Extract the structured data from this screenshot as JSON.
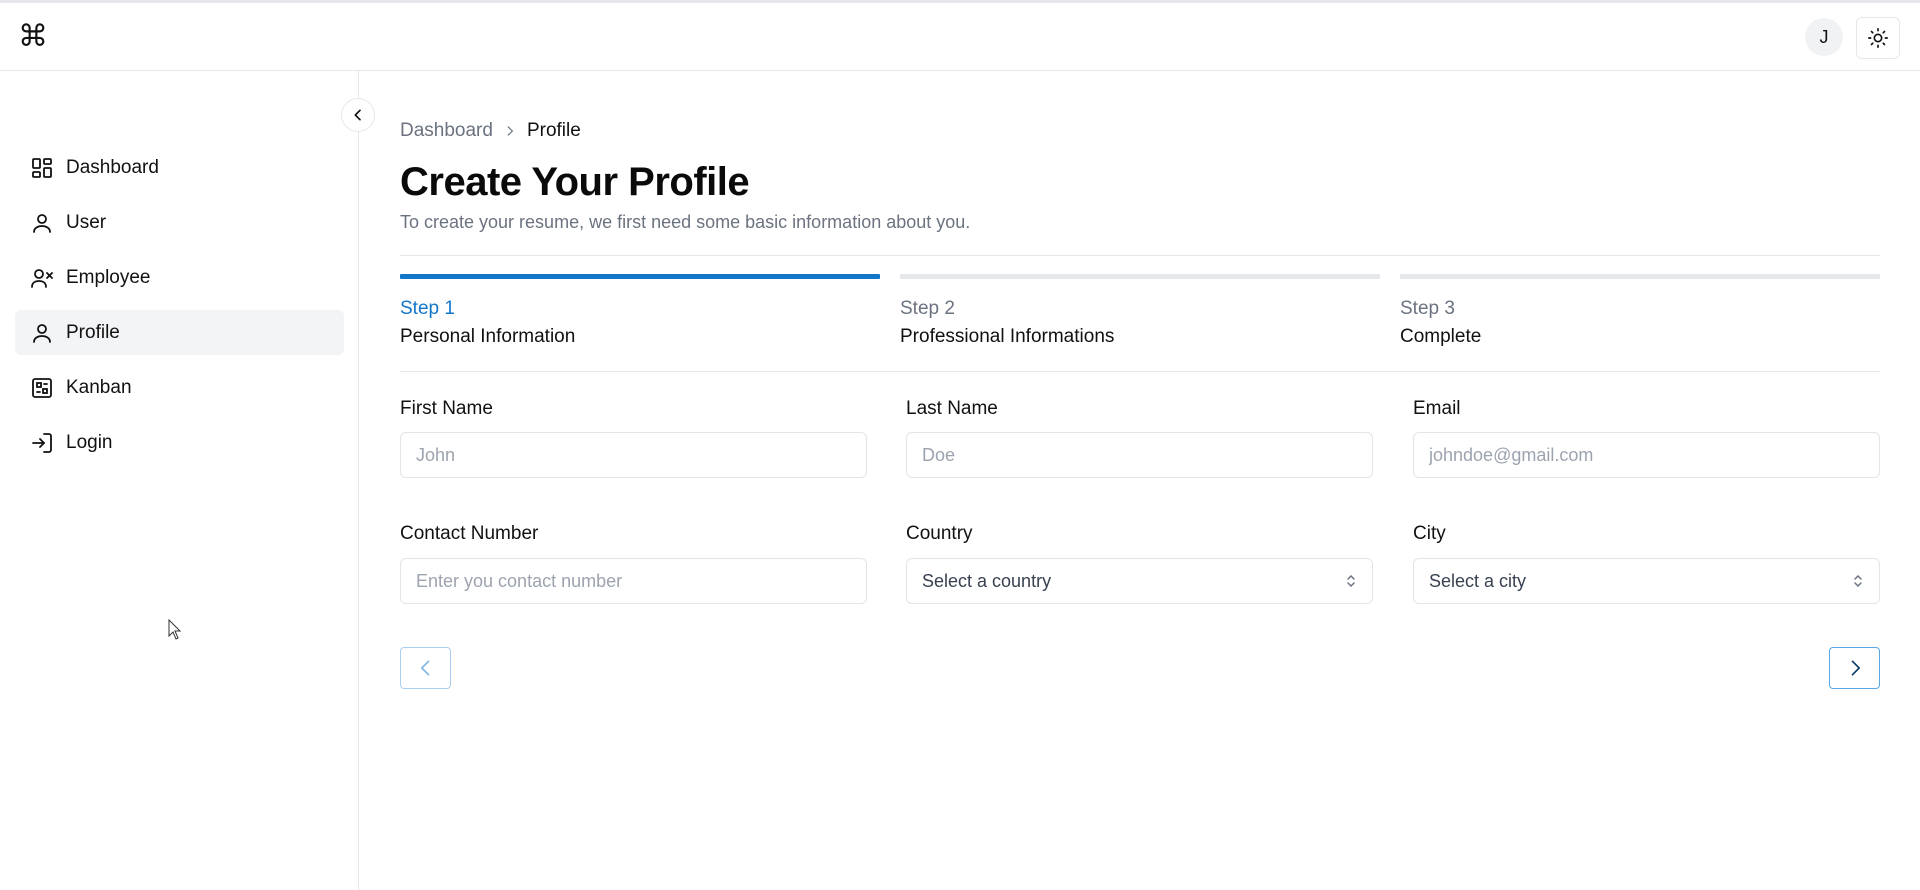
{
  "header": {
    "logo_icon": "command-icon",
    "avatar_initial": "J",
    "theme_icon": "sun-icon"
  },
  "sidebar": {
    "items": [
      {
        "label": "Dashboard",
        "icon": "dashboard-icon",
        "active": false
      },
      {
        "label": "User",
        "icon": "user-icon",
        "active": false
      },
      {
        "label": "Employee",
        "icon": "user-x-icon",
        "active": false
      },
      {
        "label": "Profile",
        "icon": "user-icon",
        "active": true
      },
      {
        "label": "Kanban",
        "icon": "kanban-icon",
        "active": false
      },
      {
        "label": "Login",
        "icon": "login-icon",
        "active": false
      }
    ]
  },
  "breadcrumb": {
    "parent": "Dashboard",
    "current": "Profile"
  },
  "page": {
    "title": "Create Your Profile",
    "subtitle": "To create your resume, we first need some basic information about you."
  },
  "steps": [
    {
      "number": "Step 1",
      "name": "Personal Information",
      "active": true
    },
    {
      "number": "Step 2",
      "name": "Professional Informations",
      "active": false
    },
    {
      "number": "Step 3",
      "name": "Complete",
      "active": false
    }
  ],
  "form": {
    "first_name": {
      "label": "First Name",
      "placeholder": "John",
      "value": ""
    },
    "last_name": {
      "label": "Last Name",
      "placeholder": "Doe",
      "value": ""
    },
    "email": {
      "label": "Email",
      "placeholder": "johndoe@gmail.com",
      "value": ""
    },
    "contact": {
      "label": "Contact Number",
      "placeholder": "Enter you contact number",
      "value": ""
    },
    "country": {
      "label": "Country",
      "selected": "Select a country"
    },
    "city": {
      "label": "City",
      "selected": "Select a city"
    }
  },
  "colors": {
    "accent": "#1476c9",
    "border": "#e5e7eb",
    "muted_text": "#6b7280"
  }
}
